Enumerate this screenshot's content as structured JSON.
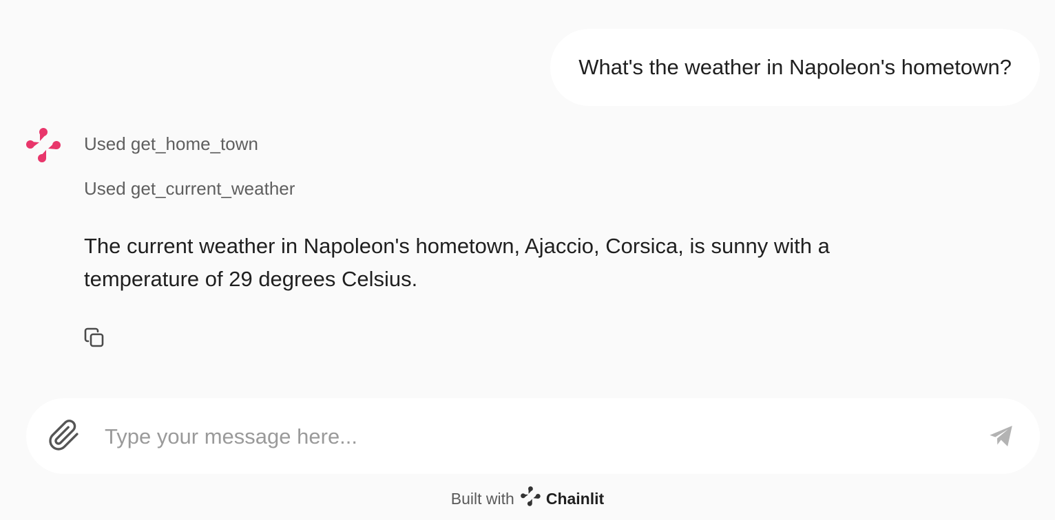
{
  "conversation": {
    "user_message": "What's the weather in Napoleon's hometown?",
    "assistant": {
      "avatar_icon": "chainlit-logo-icon",
      "avatar_color": "#e8366b",
      "steps": [
        {
          "label": "Used get_home_town"
        },
        {
          "label": "Used get_current_weather"
        }
      ],
      "message": "The current weather in Napoleon's hometown, Ajaccio, Corsica, is sunny with a temperature of 29 degrees Celsius.",
      "actions": {
        "copy_icon": "copy-icon"
      }
    }
  },
  "composer": {
    "placeholder": "Type your message here...",
    "value": "",
    "attach_icon": "paperclip-icon",
    "send_icon": "send-icon"
  },
  "footer": {
    "built_with": "Built with",
    "brand": "Chainlit",
    "brand_icon": "chainlit-logo-icon"
  }
}
